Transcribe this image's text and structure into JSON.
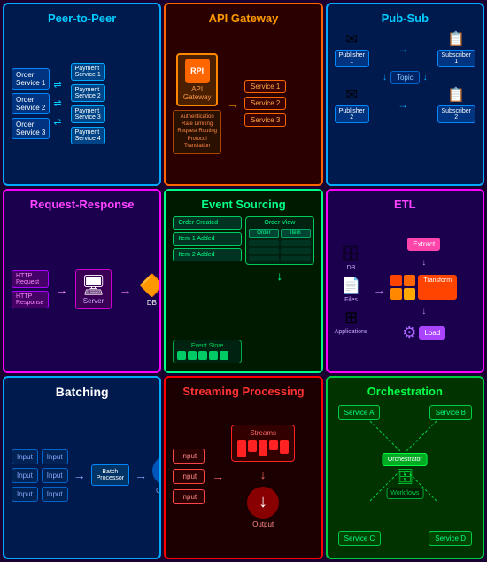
{
  "cells": {
    "peer": {
      "title": "Peer-to-Peer",
      "orders": [
        "Order\nService 1",
        "Order\nService 2",
        "Order\nService 3"
      ],
      "payments": [
        "Payment\nService 1",
        "Payment\nService 2",
        "Payment\nService 3",
        "Payment\nService 4"
      ]
    },
    "api": {
      "title": "API Gateway",
      "gateway_label": "API\nGateway",
      "rpi_label": "RPI",
      "services": [
        "Service 1",
        "Service 2",
        "Service 3"
      ],
      "auth_lines": [
        "Authentication",
        "Rate Limiting",
        "Request Routing",
        "Protocol",
        "Translation"
      ]
    },
    "pubsub": {
      "title": "Pub-Sub",
      "publishers": [
        "Publisher\n1",
        "Publisher\n2"
      ],
      "subscribers": [
        "Subscriber\n1",
        "Subscriber\n2"
      ],
      "topic": "Topic"
    },
    "reqres": {
      "title": "Request-Response",
      "http_labels": [
        "HTTP\nRequest",
        "HTTP\nResponse"
      ],
      "server_label": "Server",
      "db_label": "DB"
    },
    "eventsrc": {
      "title": "Event Sourcing",
      "events": [
        "Order Created",
        "Item 1 Added",
        "Item 2 Added"
      ],
      "store_label": "Event Store",
      "view_title": "Order View",
      "view_cols": [
        "Order",
        "Item"
      ]
    },
    "etl": {
      "title": "ETL",
      "sources": [
        "DB",
        "Files",
        "Applications"
      ],
      "steps": [
        "Extract",
        "Transform",
        "Load"
      ]
    },
    "batching": {
      "title": "Batching",
      "inputs": [
        "Input",
        "Input",
        "Input",
        "Input",
        "Input",
        "Input"
      ],
      "processor": "Batch\nProcessor",
      "output": "Output"
    },
    "streaming": {
      "title": "Streaming Processing",
      "inputs": [
        "Input",
        "Input",
        "Input"
      ],
      "streams_label": "Streams",
      "output": "Output"
    },
    "orchestration": {
      "title": "Orchestration",
      "services": [
        "Service A",
        "Service B",
        "Service C",
        "Service D"
      ],
      "orchestrator": "Orchestrator",
      "workflows": "Workflows"
    }
  }
}
